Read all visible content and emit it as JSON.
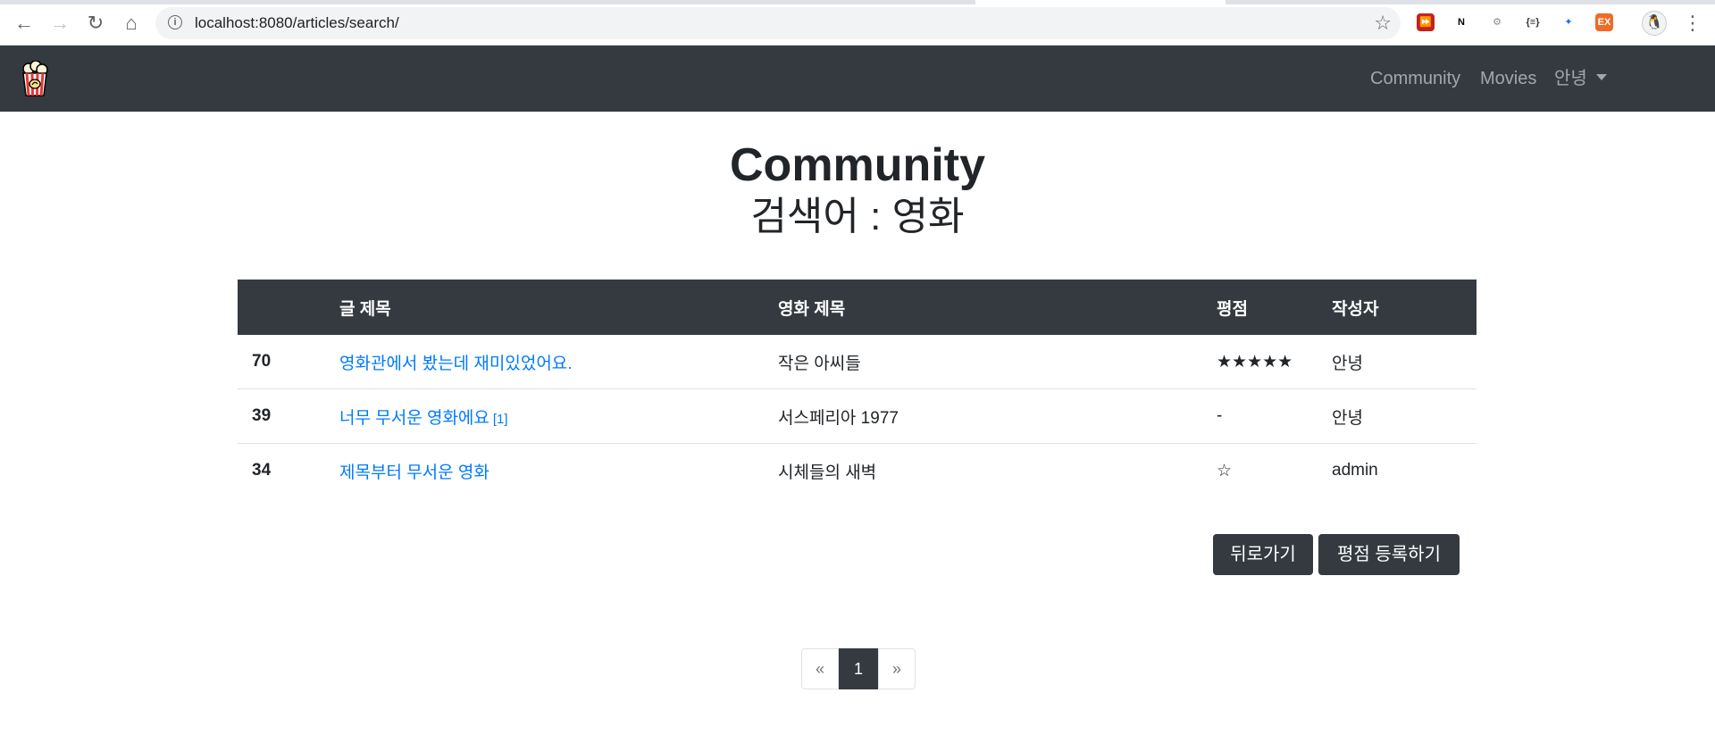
{
  "browser": {
    "url": "localhost:8080/articles/search/",
    "back_icon": "←",
    "forward_icon": "→",
    "reload_icon": "↻",
    "home_icon": "⌂",
    "info_icon": "i",
    "bookmark_icon": "☆",
    "menu_icon": "⋮",
    "extensions": [
      {
        "name": "media-extension-icon",
        "glyph": "⏩",
        "color": "#c5221f"
      },
      {
        "name": "notion-icon",
        "glyph": "N",
        "color": "#000000"
      },
      {
        "name": "settings-extension-icon",
        "glyph": "⚙",
        "color": "#8a8a8a"
      },
      {
        "name": "json-viewer-icon",
        "glyph": "{≡}",
        "color": "#333333"
      },
      {
        "name": "blue-extension-icon",
        "glyph": "✦",
        "color": "#1a73e8"
      },
      {
        "name": "ex-extension-icon",
        "glyph": "EX",
        "color": "#f06a27"
      }
    ]
  },
  "navbar": {
    "links": {
      "community": "Community",
      "movies": "Movies",
      "user": "안녕"
    }
  },
  "heading": {
    "title": "Community",
    "search": "검색어 : 영화"
  },
  "table": {
    "headers": [
      "",
      "글 제목",
      "영화 제목",
      "평점",
      "작성자"
    ],
    "rows": [
      {
        "num": "70",
        "title": "영화관에서 봤는데 재미있었어요.",
        "comments": "",
        "movie": "작은 아씨들",
        "score": "★★★★★",
        "author": "안녕"
      },
      {
        "num": "39",
        "title": "너무 무서운 영화에요",
        "comments": "[1]",
        "movie": "서스페리아 1977",
        "score": "-",
        "author": "안녕"
      },
      {
        "num": "34",
        "title": "제목부터 무서운 영화",
        "comments": "",
        "movie": "시체들의 새벽",
        "score": "☆",
        "author": "admin"
      }
    ]
  },
  "buttons": {
    "back": "뒤로가기",
    "rate": "평점 등록하기"
  },
  "pagination": {
    "prev": "«",
    "current": "1",
    "next": "»"
  },
  "colors": {
    "navbar": "#343a40",
    "link": "#007bff"
  }
}
